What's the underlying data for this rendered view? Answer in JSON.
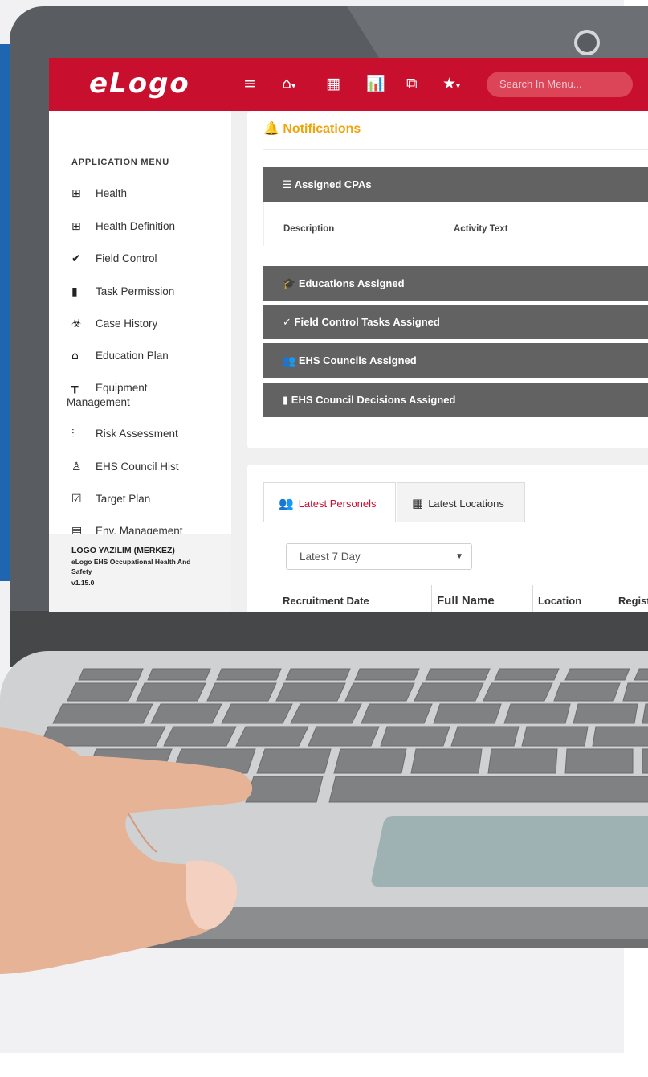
{
  "app": {
    "logo": "eLogo",
    "search_placeholder": "Search In Menu..."
  },
  "topbar": {
    "icons": [
      "menu-icon",
      "home-icon",
      "calendar-icon",
      "chart-icon",
      "copy-icon",
      "star-icon"
    ]
  },
  "sidebar": {
    "heading": "APPLICATION MENU",
    "items": [
      {
        "label": "Health",
        "icon": "plus-box-icon"
      },
      {
        "label": "Health Definition",
        "icon": "plus-box-icon"
      },
      {
        "label": "Field Control",
        "icon": "double-check-icon"
      },
      {
        "label": "Task Permission",
        "icon": "file-icon"
      },
      {
        "label": "Case History",
        "icon": "biohazard-icon"
      },
      {
        "label": "Education Plan",
        "icon": "bank-icon"
      },
      {
        "label": "Equipment Management",
        "icon": "paint-roller-icon"
      },
      {
        "label": "Risk Assessment",
        "icon": "pulse-icon"
      },
      {
        "label": "EHS Council Hist",
        "icon": "user-icon"
      },
      {
        "label": "Target Plan",
        "icon": "clipboard-check-icon"
      },
      {
        "label": "Env. Management",
        "icon": "building-icon"
      }
    ],
    "footer": {
      "org": "LOGO YAZILIM (MERKEZ)",
      "product": "eLogo EHS Occupational Health And Safety",
      "version": "v1.15.0"
    }
  },
  "notifications": {
    "title": "Notifications",
    "panels": [
      {
        "label": "Assigned CPAs",
        "icon": "list-icon"
      },
      {
        "label": "Educations Assigned",
        "icon": "graduation-cap-icon"
      },
      {
        "label": "Field Control Tasks Assigned",
        "icon": "check-icon"
      },
      {
        "label": "EHS Councils Assigned",
        "icon": "users-icon"
      },
      {
        "label": "EHS Council Decisions Assigned",
        "icon": "file-icon"
      }
    ],
    "cpa_columns": [
      "Description",
      "Activity Text"
    ]
  },
  "latest": {
    "tabs": [
      {
        "label": "Latest Personels",
        "active": true
      },
      {
        "label": "Latest Locations",
        "active": false
      }
    ],
    "period": "Latest 7 Day",
    "columns": [
      "Recruitment Date",
      "Full Name",
      "Location",
      "Regist"
    ]
  },
  "colors": {
    "brand_red": "#c8102e",
    "notification_orange": "#f0a30a",
    "panel_gray": "#636262"
  }
}
